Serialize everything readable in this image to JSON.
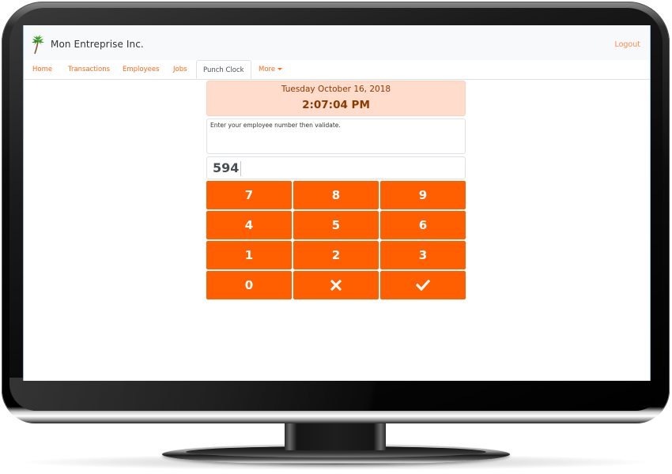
{
  "app": {
    "brand_name": "Mon Entreprise Inc.",
    "logo_icon": "palm-tree-icon",
    "logout_label": "Logout"
  },
  "nav": {
    "items": [
      {
        "label": "Home",
        "active": false
      },
      {
        "label": "Transactions",
        "active": false
      },
      {
        "label": "Employees",
        "active": false
      },
      {
        "label": "Jobs",
        "active": false
      },
      {
        "label": "Punch Clock",
        "active": true
      },
      {
        "label": "More",
        "active": false,
        "dropdown": true
      }
    ]
  },
  "punch_clock": {
    "date": "Tuesday October 16, 2018",
    "time": "2:07:04 PM",
    "message": "Enter your employee number then validate.",
    "employee_number": "594",
    "keys": [
      {
        "label": "7",
        "type": "digit"
      },
      {
        "label": "8",
        "type": "digit"
      },
      {
        "label": "9",
        "type": "digit"
      },
      {
        "label": "4",
        "type": "digit"
      },
      {
        "label": "5",
        "type": "digit"
      },
      {
        "label": "6",
        "type": "digit"
      },
      {
        "label": "1",
        "type": "digit"
      },
      {
        "label": "2",
        "type": "digit"
      },
      {
        "label": "3",
        "type": "digit"
      },
      {
        "label": "0",
        "type": "digit"
      },
      {
        "label": "",
        "type": "clear",
        "icon": "times-icon"
      },
      {
        "label": "",
        "type": "validate",
        "icon": "check-icon"
      }
    ]
  },
  "colors": {
    "accent": "#ff5f00",
    "link": "#ff6a1a",
    "clock_background": "#ffdccb",
    "clock_text": "#8a3a00"
  }
}
